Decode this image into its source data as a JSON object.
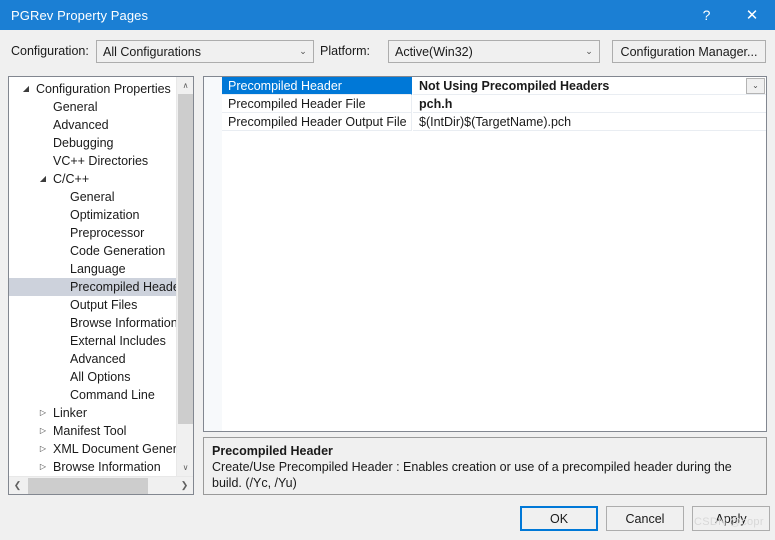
{
  "window": {
    "title": "PGRev Property Pages",
    "help_glyph": "?",
    "close_glyph": "✕",
    "titlebar_color": "#1b7fd4"
  },
  "config_bar": {
    "configuration_label": "Configuration:",
    "configuration_value": "All Configurations",
    "platform_label": "Platform:",
    "platform_value": "Active(Win32)",
    "configuration_manager_label": "Configuration Manager...",
    "chevron_glyph": "⌄"
  },
  "tree": {
    "expanded_glyph": "◢",
    "collapsed_glyph": "▷",
    "items": [
      {
        "label": "Configuration Properties",
        "level": 0,
        "state": "expanded",
        "selected": false
      },
      {
        "label": "General",
        "level": 1,
        "state": "leaf",
        "selected": false
      },
      {
        "label": "Advanced",
        "level": 1,
        "state": "leaf",
        "selected": false
      },
      {
        "label": "Debugging",
        "level": 1,
        "state": "leaf",
        "selected": false
      },
      {
        "label": "VC++ Directories",
        "level": 1,
        "state": "leaf",
        "selected": false
      },
      {
        "label": "C/C++",
        "level": 1,
        "state": "expanded",
        "selected": false
      },
      {
        "label": "General",
        "level": 2,
        "state": "leaf",
        "selected": false
      },
      {
        "label": "Optimization",
        "level": 2,
        "state": "leaf",
        "selected": false
      },
      {
        "label": "Preprocessor",
        "level": 2,
        "state": "leaf",
        "selected": false
      },
      {
        "label": "Code Generation",
        "level": 2,
        "state": "leaf",
        "selected": false
      },
      {
        "label": "Language",
        "level": 2,
        "state": "leaf",
        "selected": false
      },
      {
        "label": "Precompiled Headers",
        "level": 2,
        "state": "leaf",
        "selected": true
      },
      {
        "label": "Output Files",
        "level": 2,
        "state": "leaf",
        "selected": false
      },
      {
        "label": "Browse Information",
        "level": 2,
        "state": "leaf",
        "selected": false
      },
      {
        "label": "External Includes",
        "level": 2,
        "state": "leaf",
        "selected": false
      },
      {
        "label": "Advanced",
        "level": 2,
        "state": "leaf",
        "selected": false
      },
      {
        "label": "All Options",
        "level": 2,
        "state": "leaf",
        "selected": false
      },
      {
        "label": "Command Line",
        "level": 2,
        "state": "leaf",
        "selected": false
      },
      {
        "label": "Linker",
        "level": 1,
        "state": "collapsed",
        "selected": false
      },
      {
        "label": "Manifest Tool",
        "level": 1,
        "state": "collapsed",
        "selected": false
      },
      {
        "label": "XML Document Generator",
        "level": 1,
        "state": "collapsed",
        "selected": false
      },
      {
        "label": "Browse Information",
        "level": 1,
        "state": "collapsed",
        "selected": false
      }
    ],
    "scroll_up_glyph": "∧",
    "scroll_down_glyph": "∨",
    "scroll_left_glyph": "❮",
    "scroll_right_glyph": "❯"
  },
  "grid": {
    "rows": [
      {
        "name": "Precompiled Header",
        "value": "Not Using Precompiled Headers",
        "bold": true,
        "selected": true
      },
      {
        "name": "Precompiled Header File",
        "value": "pch.h",
        "bold": true,
        "selected": false
      },
      {
        "name": "Precompiled Header Output File",
        "value": "$(IntDir)$(TargetName).pch",
        "bold": false,
        "selected": false
      }
    ],
    "dropdown_glyph": "⌄",
    "selection_color": "#0078d7"
  },
  "description": {
    "title": "Precompiled Header",
    "body": "Create/Use Precompiled Header : Enables creation or use of a precompiled header during the build. (/Yc, /Yu)"
  },
  "buttons": {
    "ok": "OK",
    "cancel": "Cancel",
    "apply": "Apply",
    "default_focus_color": "#0078d7"
  },
  "watermark": {
    "text": "CSDN @copr"
  }
}
